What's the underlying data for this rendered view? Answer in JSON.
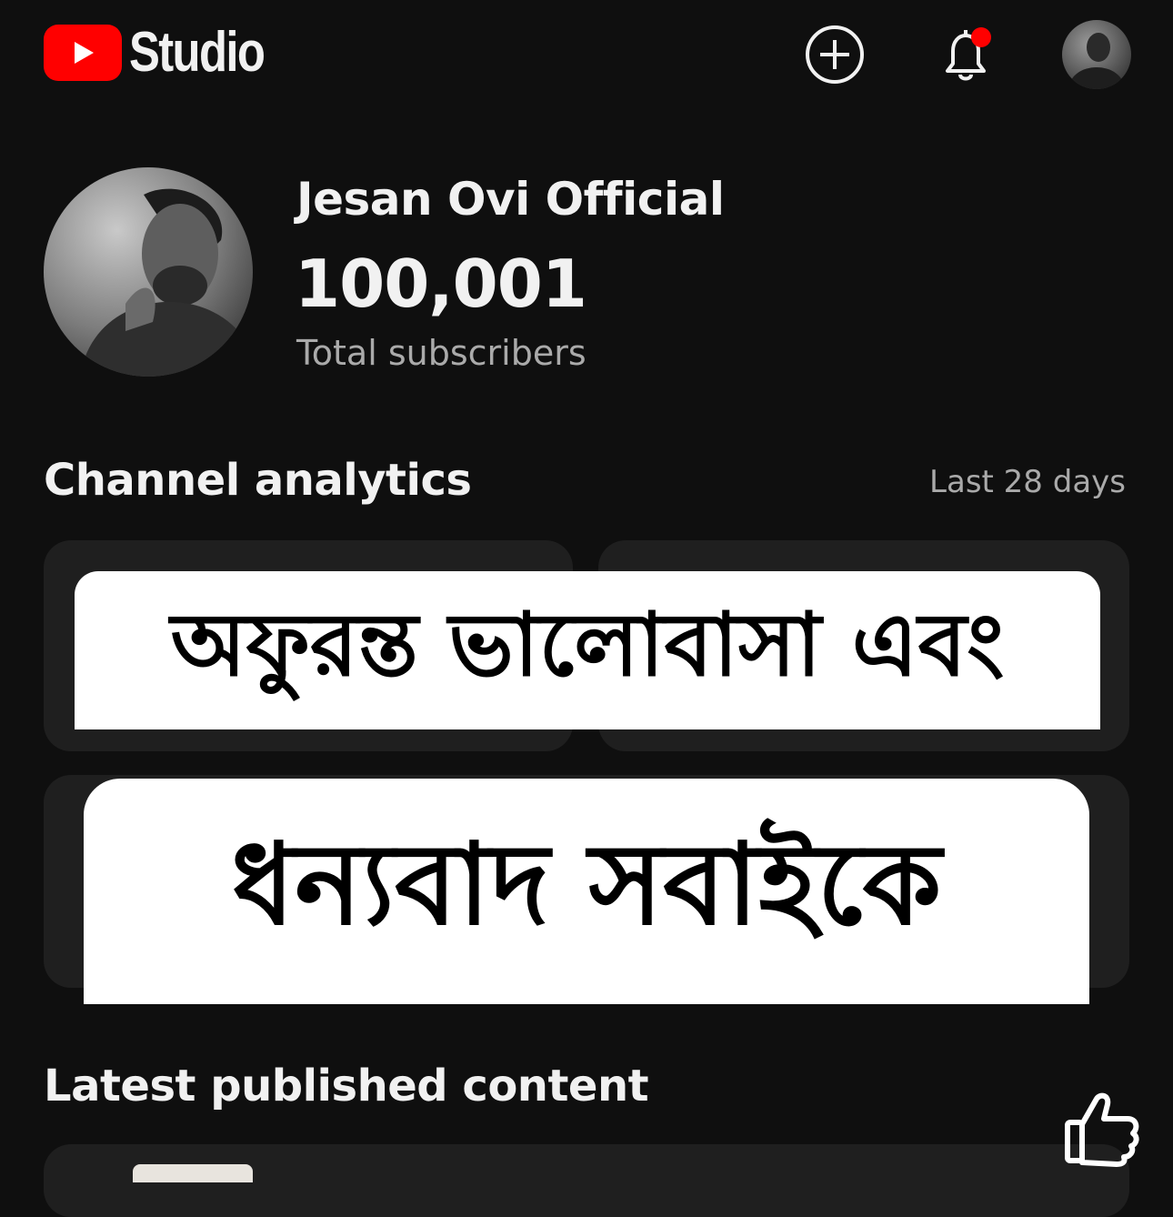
{
  "header": {
    "app_name": "Studio",
    "create_icon": "plus-circle-icon",
    "notifications_icon": "bell-icon",
    "notification_dot_color": "#ff0000",
    "account_icon": "avatar"
  },
  "channel": {
    "name": "Jesan Ovi Official",
    "subscriber_count": "100,001",
    "subscriber_label": "Total subscribers"
  },
  "analytics": {
    "title": "Channel analytics",
    "range": "Last 28 days"
  },
  "overlay": {
    "line_1": "অফুরন্ত ভালোবাসা এবং",
    "line_2": "ধন্যবাদ সবাইকে"
  },
  "latest": {
    "title": "Latest published content"
  },
  "colors": {
    "background": "#0f0f0f",
    "card": "#1f1f1f",
    "brand_red": "#ff0000",
    "text_primary": "#f1f1f1",
    "text_secondary": "#aaaaaa"
  }
}
